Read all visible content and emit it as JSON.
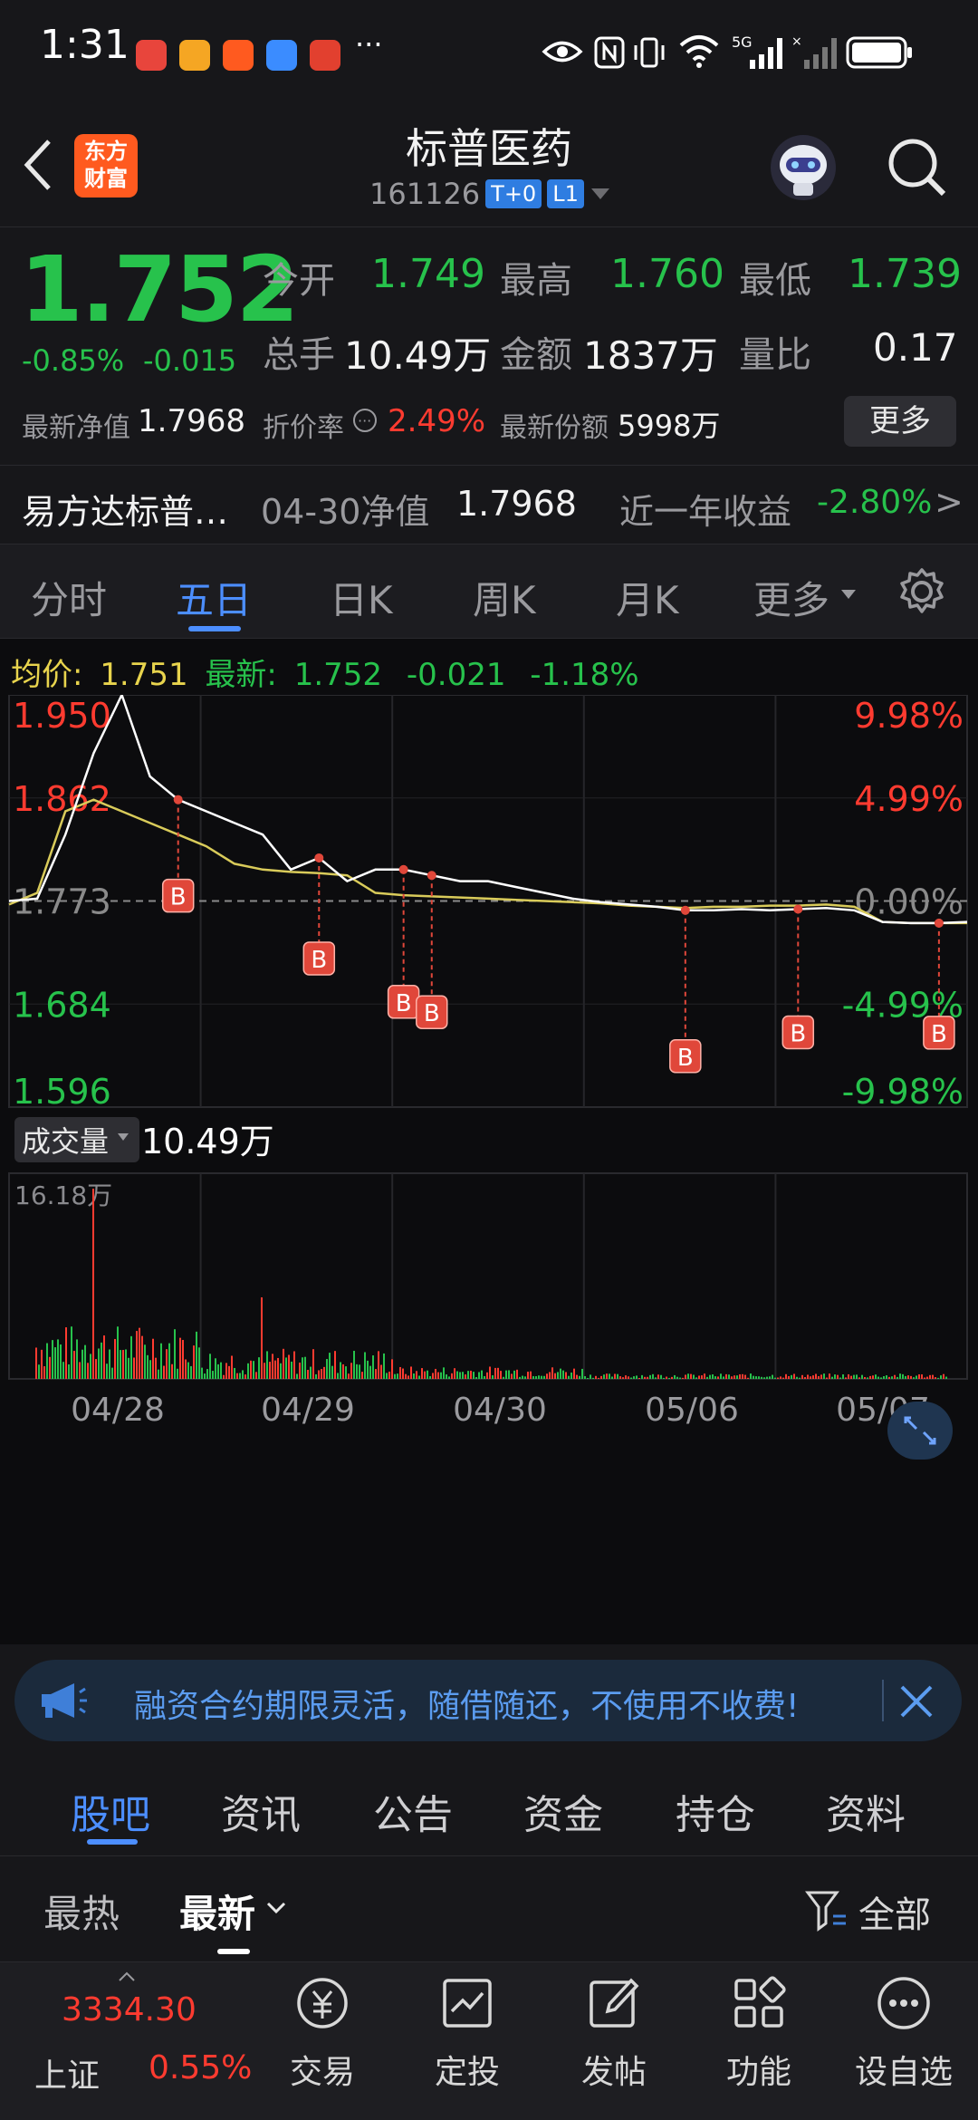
{
  "status_bar": {
    "time": "1:31",
    "more": "···",
    "icons": [
      "app-icon",
      "weibo-icon",
      "app-icon",
      "cloud-icon",
      "game-icon",
      "eye-icon",
      "nfc-icon",
      "vibrate-icon",
      "wifi-icon",
      "signal-5g-icon",
      "signal-icon",
      "battery-icon"
    ]
  },
  "header": {
    "logo_line1": "东方",
    "logo_line2": "财富",
    "title": "标普医药",
    "code": "161126",
    "badge_t0": "T+0",
    "badge_l1": "L1"
  },
  "quote": {
    "price": "1.752",
    "change_pct": "-0.85%",
    "change": "-0.015",
    "open_label": "今开",
    "open": "1.749",
    "high_label": "最高",
    "high": "1.760",
    "low_label": "最低",
    "low": "1.739",
    "volume_label": "总手",
    "volume": "10.49万",
    "amount_label": "金额",
    "amount": "1837万",
    "ratio_label": "量比",
    "ratio": "0.17",
    "nav_label": "最新净值",
    "nav": "1.7968",
    "discount_label": "折价率",
    "discount": "2.49%",
    "shares_label": "最新份额",
    "shares": "5998万",
    "more_button": "更多",
    "fund_name": "易方达标普…",
    "nav_date_label": "04-30净值",
    "nav_date_value": "1.7968",
    "yearly_label": "近一年收益",
    "yearly_value": "-2.80%",
    "chevron": ">"
  },
  "period_tabs": [
    "分时",
    "五日",
    "日K",
    "周K",
    "月K",
    "更多"
  ],
  "period_active": 1,
  "chart_header": {
    "avg_label": "均价:",
    "avg_value": "1.751",
    "latest_label": "最新:",
    "latest_value": "1.752",
    "change": "-0.021",
    "change_pct": "-1.18%"
  },
  "chart_data": {
    "type": "line",
    "y_left_ticks": [
      "1.950",
      "1.862",
      "1.773",
      "1.684",
      "1.596"
    ],
    "y_right_ticks": [
      "9.98%",
      "4.99%",
      "0.00%",
      "-4.99%",
      "-9.98%"
    ],
    "ylim": [
      1.596,
      1.95
    ],
    "prev_close": 1.773,
    "x_labels": [
      "04/28",
      "04/29",
      "04/30",
      "05/06",
      "05/07"
    ],
    "series": [
      {
        "values": [
          1.773,
          1.775,
          1.83,
          1.9,
          1.95,
          1.88,
          1.86,
          1.85,
          1.84,
          1.83,
          1.8,
          1.81,
          1.79,
          1.8,
          1.8,
          1.795,
          1.79,
          1.79,
          1.785,
          1.78,
          1.775,
          1.772,
          1.77,
          1.768,
          1.765,
          1.765,
          1.766,
          1.765,
          1.766,
          1.767,
          1.765,
          1.755,
          1.754,
          1.754,
          1.755
        ]
      },
      {
        "values": [
          1.77,
          1.78,
          1.85,
          1.86,
          1.85,
          1.84,
          1.83,
          1.82,
          1.805,
          1.8,
          1.798,
          1.797,
          1.795,
          1.78,
          1.778,
          1.777,
          1.776,
          1.775,
          1.774,
          1.773,
          1.772,
          1.771,
          1.769,
          1.768,
          1.767,
          1.768,
          1.768,
          1.769,
          1.769,
          1.77,
          1.768,
          1.755,
          1.754,
          1.754,
          1.754
        ]
      }
    ],
    "buy_markers": [
      "B",
      "B",
      "B",
      "B",
      "B",
      "B",
      "B"
    ],
    "volume_label": "成交量",
    "volume_value": "10.49万",
    "volume_max": "16.18万"
  },
  "banner": {
    "text": "融资合约期限灵活，随借随还，不使用不收费!"
  },
  "section_tabs": [
    "股吧",
    "资讯",
    "公告",
    "资金",
    "持仓",
    "资料"
  ],
  "section_active": 0,
  "filters": {
    "hot": "最热",
    "latest": "最新",
    "all": "全部"
  },
  "bottom_nav": {
    "index_value": "3334.30",
    "index_name": "上证",
    "index_change": "0.55%",
    "items": [
      "交易",
      "定投",
      "发帖",
      "功能",
      "设自选"
    ]
  }
}
